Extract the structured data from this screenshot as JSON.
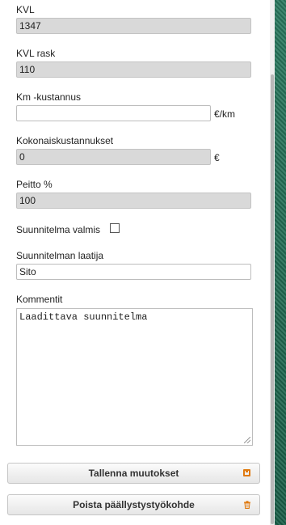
{
  "form": {
    "kvl": {
      "label": "KVL",
      "value": "1347"
    },
    "kvl_rask": {
      "label": "KVL rask",
      "value": "110"
    },
    "km_kustannus": {
      "label": "Km -kustannus",
      "value": "",
      "unit": "€/km"
    },
    "kokonaiskustannukset": {
      "label": "Kokonaiskustannukset",
      "value": "0",
      "unit": "€"
    },
    "peitto": {
      "label": "Peitto %",
      "value": "100"
    },
    "suunnitelma_valmis": {
      "label": "Suunnitelma valmis",
      "checked": false
    },
    "laatija": {
      "label": "Suunnitelman laatija",
      "value": "Sito"
    },
    "kommentit": {
      "label": "Kommentit",
      "value": "Laadittava suunnitelma"
    }
  },
  "buttons": {
    "save": {
      "label": "Tallenna muutokset",
      "icon": "save-icon"
    },
    "delete": {
      "label": "Poista päällystystyökohde",
      "icon": "trash-icon"
    }
  },
  "colors": {
    "accent": "#e07a10",
    "readonly_bg": "#d9d9d9"
  }
}
